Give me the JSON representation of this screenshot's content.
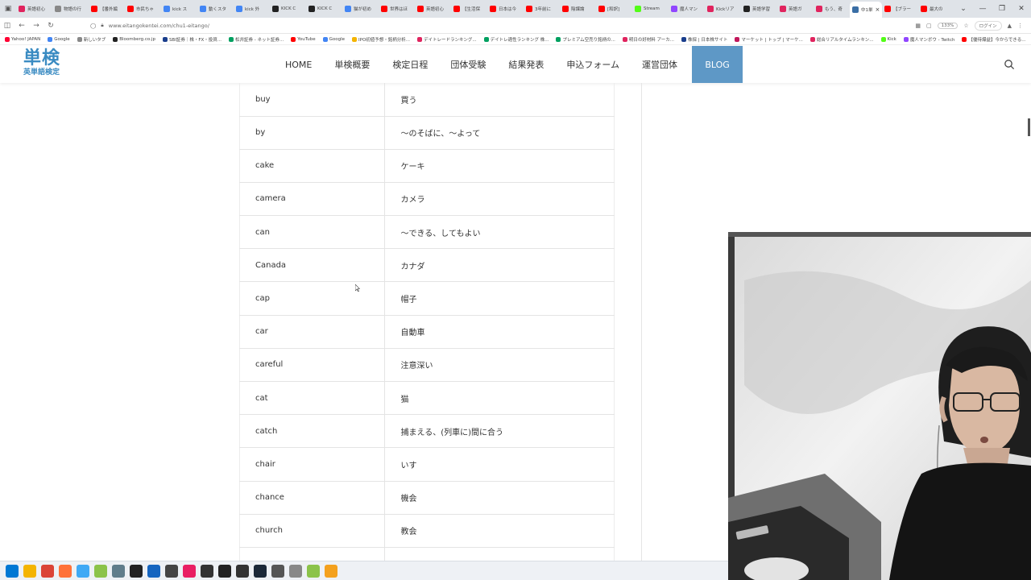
{
  "browser": {
    "tabs": [
      {
        "label": "英語初心",
        "color": "#e0245e"
      },
      {
        "label": "物語の行",
        "color": "#888888"
      },
      {
        "label": "【番外編",
        "color": "#ff0000"
      },
      {
        "label": "市民ちゃ",
        "color": "#ff0000"
      },
      {
        "label": "kick ス",
        "color": "#4285f4"
      },
      {
        "label": "動くスタ",
        "color": "#4285f4"
      },
      {
        "label": "kick 外",
        "color": "#4285f4"
      },
      {
        "label": "KICK C",
        "color": "#222222"
      },
      {
        "label": "KICK C",
        "color": "#222222"
      },
      {
        "label": "猫が初め",
        "color": "#4285f4"
      },
      {
        "label": "世界はほ",
        "color": "#ff0000"
      },
      {
        "label": "英語初心",
        "color": "#ff0000"
      },
      {
        "label": "【生活保",
        "color": "#ff0000"
      },
      {
        "label": "日本は今",
        "color": "#ff0000"
      },
      {
        "label": "3年前に",
        "color": "#ff0000"
      },
      {
        "label": "陰謀論",
        "color": "#ff0000"
      },
      {
        "label": "[和訳]",
        "color": "#ff0000"
      },
      {
        "label": "Stream",
        "color": "#53fc18"
      },
      {
        "label": "魔人マン",
        "color": "#9146ff"
      },
      {
        "label": "Kickリア",
        "color": "#e0245e"
      },
      {
        "label": "英語学習",
        "color": "#222222"
      },
      {
        "label": "英語ガ",
        "color": "#e0245e"
      },
      {
        "label": "もう、奇",
        "color": "#e0245e"
      },
      {
        "label": "中1単",
        "color": "#3a6ea5",
        "active": true
      },
      {
        "label": "【ブラー",
        "color": "#ff0000"
      },
      {
        "label": "最大の",
        "color": "#ff0000"
      }
    ],
    "url": "www.eitangokentei.com/chu1-eitango/",
    "zoom": "133%",
    "login_label": "ログイン",
    "bookmarks": [
      {
        "label": "Yahoo! JAPAN",
        "color": "#ff0033"
      },
      {
        "label": "Google",
        "color": "#4285f4"
      },
      {
        "label": "新しいタブ",
        "color": "#888888"
      },
      {
        "label": "Bloomberg.co.jp",
        "color": "#222222"
      },
      {
        "label": "SBI証券｜株・FX・投資...",
        "color": "#1a3e8c"
      },
      {
        "label": "松井証券 - ネット証券...",
        "color": "#00a060"
      },
      {
        "label": "YouTube",
        "color": "#ff0000"
      },
      {
        "label": "Google",
        "color": "#4285f4"
      },
      {
        "label": "IPO初値予想・銘柄分析...",
        "color": "#f4b400"
      },
      {
        "label": "デイトレードランキング...",
        "color": "#e0245e"
      },
      {
        "label": "デイトレ適性ランキング 株...",
        "color": "#00a060"
      },
      {
        "label": "プレミアム空売り銘柄の...",
        "color": "#00a060"
      },
      {
        "label": "明日の好材料 アーカ...",
        "color": "#e0245e"
      },
      {
        "label": "株探 | 日本株サイト",
        "color": "#1a3e8c"
      },
      {
        "label": "マーケット | トップ | マーケ...",
        "color": "#c2185b"
      },
      {
        "label": "総合リアルタイムランキン...",
        "color": "#e0245e"
      },
      {
        "label": "Kick",
        "color": "#53fc18"
      },
      {
        "label": "魔人マンボウ - Twitch",
        "color": "#9146ff"
      },
      {
        "label": "【優待爆益】今からできる...",
        "color": "#ff0000"
      }
    ]
  },
  "site": {
    "logo_main": "単検",
    "logo_sub": "英単語検定",
    "nav": [
      "HOME",
      "単検概要",
      "検定日程",
      "団体受験",
      "結果発表",
      "申込フォーム",
      "運営団体",
      "BLOG"
    ]
  },
  "vocab": [
    {
      "word": "buy",
      "meaning": "買う"
    },
    {
      "word": "by",
      "meaning": "～のそばに、～よって"
    },
    {
      "word": "cake",
      "meaning": "ケーキ"
    },
    {
      "word": "camera",
      "meaning": "カメラ"
    },
    {
      "word": "can",
      "meaning": "～できる、してもよい"
    },
    {
      "word": "Canada",
      "meaning": "カナダ"
    },
    {
      "word": "cap",
      "meaning": "帽子"
    },
    {
      "word": "car",
      "meaning": "自動車"
    },
    {
      "word": "careful",
      "meaning": "注意深い"
    },
    {
      "word": "cat",
      "meaning": "猫"
    },
    {
      "word": "catch",
      "meaning": "捕まえる、(列車に)間に合う"
    },
    {
      "word": "chair",
      "meaning": "いす"
    },
    {
      "word": "chance",
      "meaning": "機会"
    },
    {
      "word": "church",
      "meaning": "教会"
    },
    {
      "word": "",
      "meaning": ""
    }
  ],
  "taskbar": [
    {
      "name": "windows-start-icon",
      "color": "#0078d4"
    },
    {
      "name": "file-explorer-icon",
      "color": "#f4b400"
    },
    {
      "name": "chrome-icon",
      "color": "#db4437"
    },
    {
      "name": "firefox-icon",
      "color": "#ff7139"
    },
    {
      "name": "app-icon",
      "color": "#3fa9f5"
    },
    {
      "name": "app-icon",
      "color": "#8bc34a"
    },
    {
      "name": "app-icon",
      "color": "#607d8b"
    },
    {
      "name": "record-icon",
      "color": "#222222"
    },
    {
      "name": "app-icon",
      "color": "#1565c0"
    },
    {
      "name": "app-icon",
      "color": "#444444"
    },
    {
      "name": "app-icon",
      "color": "#e91e63"
    },
    {
      "name": "terminal-icon",
      "color": "#333333"
    },
    {
      "name": "app-icon",
      "color": "#222222"
    },
    {
      "name": "app-icon",
      "color": "#333333"
    },
    {
      "name": "steam-icon",
      "color": "#1b2838"
    },
    {
      "name": "app-icon",
      "color": "#555555"
    },
    {
      "name": "app-icon",
      "color": "#888888"
    },
    {
      "name": "app-icon",
      "color": "#8bc34a"
    },
    {
      "name": "app-icon",
      "color": "#f4a11e"
    }
  ],
  "colors": {
    "accent": "#5e98c6",
    "logo": "#3a8bc2"
  }
}
